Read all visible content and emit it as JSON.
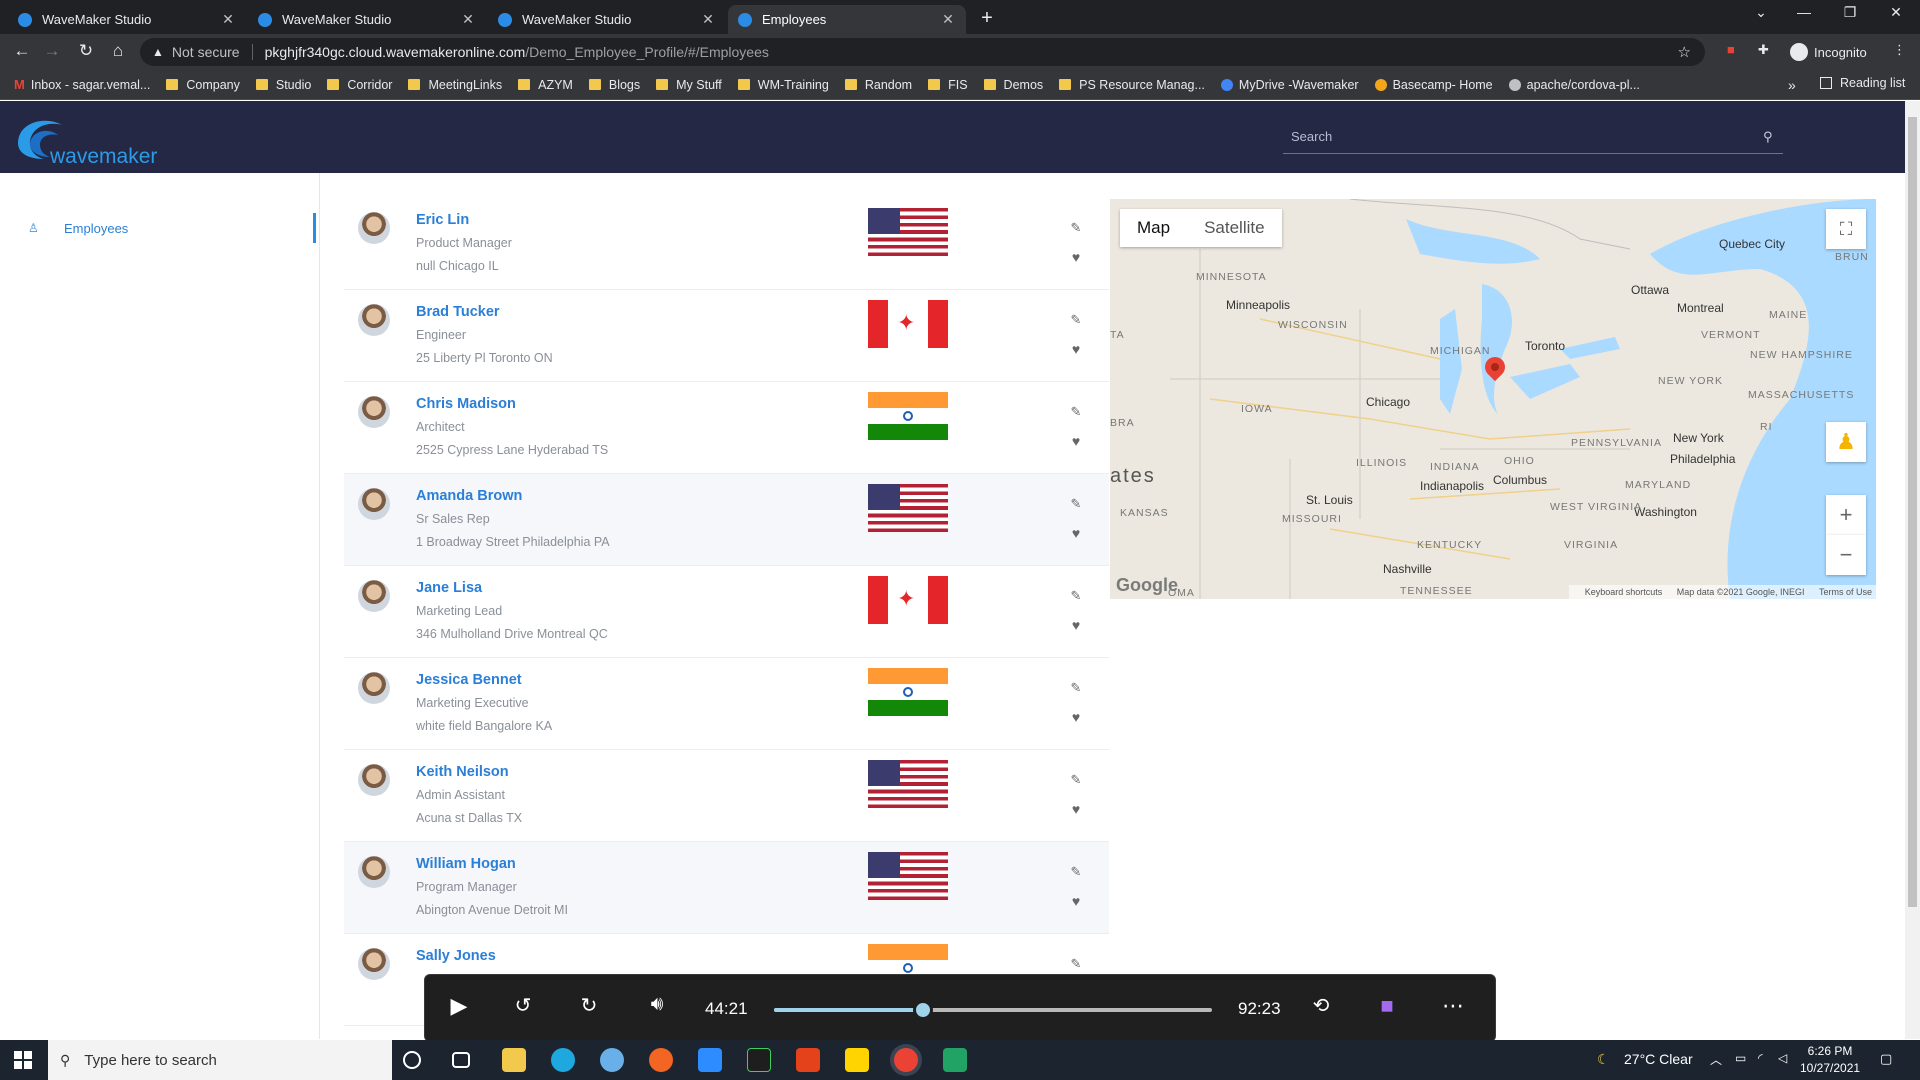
{
  "browser": {
    "tabs": [
      {
        "title": "WaveMaker Studio",
        "active": false
      },
      {
        "title": "WaveMaker Studio",
        "active": false
      },
      {
        "title": "WaveMaker Studio",
        "active": false
      },
      {
        "title": "Employees",
        "active": true
      }
    ],
    "security_label": "Not secure",
    "url_host": "pkghjfr340gc.cloud.wavemakeronline.com",
    "url_path": "/Demo_Employee_Profile/#/Employees",
    "profile_label": "Incognito",
    "bookmarks": [
      "Inbox - sagar.vemal...",
      "Company",
      "Studio",
      "Corridor",
      "MeetingLinks",
      "AZYM",
      "Blogs",
      "My Stuff",
      "WM-Training",
      "Random",
      "FIS",
      "Demos",
      "PS Resource Manag...",
      "MyDrive -Wavemaker",
      "Basecamp- Home",
      "apache/cordova-pl..."
    ],
    "reading_list": "Reading list"
  },
  "app": {
    "logo_text": "wavemaker",
    "search_placeholder": "Search",
    "nav": [
      {
        "label": "Employees",
        "icon": "user-icon"
      }
    ]
  },
  "employees": [
    {
      "name": "Eric Lin",
      "title": "Product Manager",
      "address": "null Chicago IL",
      "country": "us"
    },
    {
      "name": "Brad Tucker",
      "title": "Engineer",
      "address": "25 Liberty Pl Toronto ON",
      "country": "ca"
    },
    {
      "name": "Chris Madison",
      "title": "Architect",
      "address": "2525 Cypress Lane Hyderabad TS",
      "country": "in"
    },
    {
      "name": "Amanda Brown",
      "title": "Sr Sales Rep",
      "address": "1 Broadway Street Philadelphia PA",
      "country": "us"
    },
    {
      "name": "Jane Lisa",
      "title": "Marketing Lead",
      "address": "346 Mulholland Drive Montreal QC",
      "country": "ca"
    },
    {
      "name": "Jessica Bennet",
      "title": "Marketing Executive",
      "address": "white field Bangalore KA",
      "country": "in"
    },
    {
      "name": "Keith Neilson",
      "title": "Admin Assistant",
      "address": "Acuna st Dallas TX",
      "country": "us"
    },
    {
      "name": "William Hogan",
      "title": "Program Manager",
      "address": "Abington Avenue Detroit MI",
      "country": "us"
    },
    {
      "name": "Sally Jones",
      "title": "",
      "address": "",
      "country": "in"
    }
  ],
  "map": {
    "tabs": [
      "Map",
      "Satellite"
    ],
    "active_tab": "Map",
    "labels": {
      "minnesota": "MINNESOTA",
      "minneapolis": "Minneapolis",
      "wisconsin": "WISCONSIN",
      "michigan": "MICHIGAN",
      "iowa": "IOWA",
      "chicago": "Chicago",
      "toronto": "Toronto",
      "ottawa": "Ottawa",
      "montreal": "Montreal",
      "quebec": "Quebec City",
      "maine": "MAINE",
      "vermont": "VERMONT",
      "new_hampshire": "NEW HAMPSHIRE",
      "massachusetts": "MASSACHUSETTS",
      "new_york_state": "NEW YORK",
      "new_york": "New York",
      "ri": "RI",
      "pennsylvania": "PENNSYLVANIA",
      "philadelphia": "Philadelphia",
      "ohio": "OHIO",
      "columbus": "Columbus",
      "illinois": "ILLINOIS",
      "indiana": "INDIANA",
      "indianapolis": "Indianapolis",
      "maryland": "MARYLAND",
      "washington": "Washington",
      "west_virginia": "WEST VIRGINIA",
      "virginia": "VIRGINIA",
      "st_louis": "St. Louis",
      "missouri": "MISSOURI",
      "kansas": "KANSAS",
      "kentucky": "KENTUCKY",
      "nashville": "Nashville",
      "tennessee": "TENNESSEE",
      "oklahoma": "OMA",
      "nebraska": "BRA",
      "dakota": "TA",
      "states": "ates",
      "brunswick": "BRUN"
    },
    "google_logo": "Google",
    "footer": [
      "Keyboard shortcuts",
      "Map data ©2021 Google, INEGI",
      "Terms of Use"
    ]
  },
  "player": {
    "current": "44:21",
    "total": "92:23",
    "progress": 0.34
  },
  "taskbar": {
    "search_placeholder": "Type here to search",
    "weather": "27°C  Clear",
    "time": "6:26 PM",
    "date": "10/27/2021"
  }
}
